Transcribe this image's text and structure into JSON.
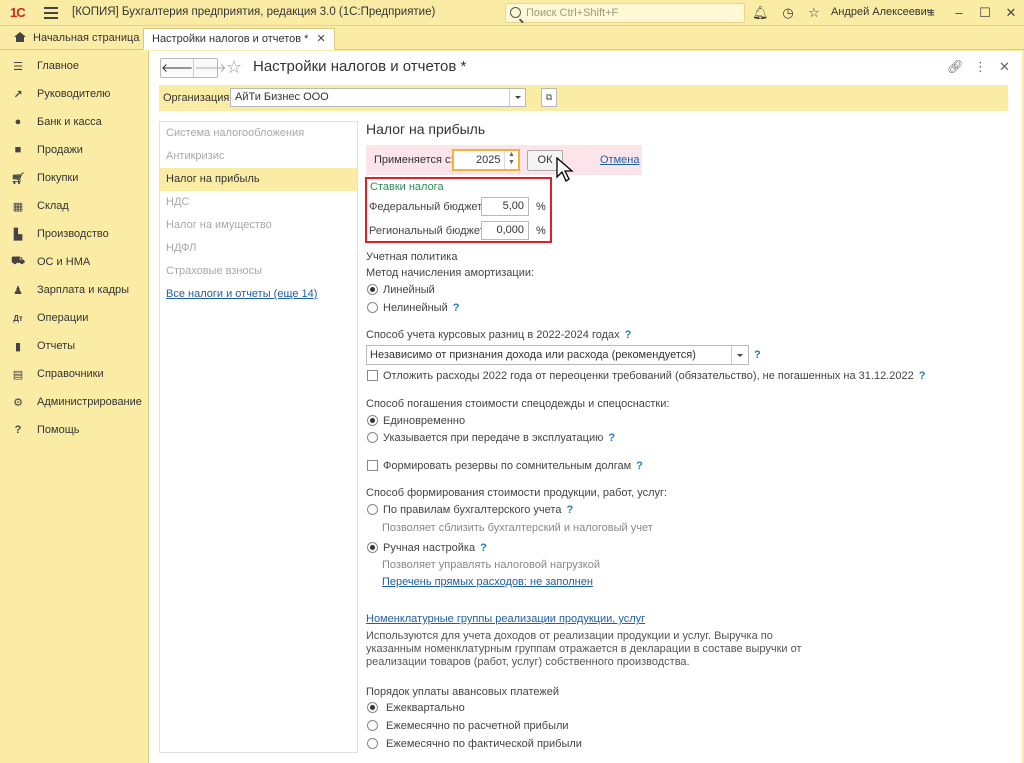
{
  "titlebar": {
    "logo": "1С",
    "title": "[КОПИЯ] Бухгалтерия предприятия, редакция 3.0  (1С:Предприятие)",
    "search_placeholder": "Поиск Ctrl+Shift+F",
    "user": "Андрей Алексеевич"
  },
  "tabs": [
    {
      "label": "Начальная страница"
    },
    {
      "label": "Настройки налогов и отчетов *"
    }
  ],
  "sidebar": {
    "items": [
      {
        "label": "Главное",
        "icon": "menu-icon"
      },
      {
        "label": "Руководителю",
        "icon": "chart-icon"
      },
      {
        "label": "Банк и касса",
        "icon": "coin-icon"
      },
      {
        "label": "Продажи",
        "icon": "bag-icon"
      },
      {
        "label": "Покупки",
        "icon": "cart-icon"
      },
      {
        "label": "Склад",
        "icon": "grid-icon"
      },
      {
        "label": "Производство",
        "icon": "factory-icon"
      },
      {
        "label": "ОС и НМА",
        "icon": "truck-icon"
      },
      {
        "label": "Зарплата и кадры",
        "icon": "person-icon"
      },
      {
        "label": "Операции",
        "icon": "dt-kt-icon"
      },
      {
        "label": "Отчеты",
        "icon": "bar-chart-icon"
      },
      {
        "label": "Справочники",
        "icon": "book-icon"
      },
      {
        "label": "Администрирование",
        "icon": "gear-icon"
      },
      {
        "label": "Помощь",
        "icon": "question-icon"
      }
    ]
  },
  "header": {
    "title": "Настройки налогов и отчетов *",
    "back": "🡐",
    "forward": "🡒"
  },
  "org": {
    "label": "Организация:",
    "value": "АйТи Бизнес ООО"
  },
  "left_panel": {
    "items": [
      {
        "label": "Система налогообложения"
      },
      {
        "label": "Антикризис"
      },
      {
        "label": "Налог на прибыль"
      },
      {
        "label": "НДС"
      },
      {
        "label": "Налог на имущество"
      },
      {
        "label": "НДФЛ"
      },
      {
        "label": "Страховые взносы"
      },
      {
        "label": "Все налоги и отчеты (еще 14)"
      }
    ]
  },
  "form": {
    "title": "Налог на прибыль",
    "applies_label": "Применяется с:",
    "year": "2025",
    "ok": "ОК",
    "cancel": "Отмена",
    "rates_title": "Ставки налога",
    "federal_label": "Федеральный бюджет:",
    "federal_value": "5,00",
    "regional_label": "Региональный бюджет:",
    "regional_value": "0,000",
    "pct": "%",
    "policy_title": "Учетная политика",
    "amort_label": "Метод начисления амортизации:",
    "amort_linear": "Линейный",
    "amort_nonlinear": "Нелинейный",
    "q": "?",
    "fx_label": "Способ учета курсовых разниц в 2022-2024 годах",
    "fx_value": "Независимо от признания дохода или расхода (рекомендуется)",
    "defer_label": "Отложить расходы 2022 года от переоценки требований (обязательство), не погашенных на 31.12.2022",
    "workwear_label": "Способ погашения стоимости спецодежды и спецоснастки:",
    "workwear_once": "Единовременно",
    "workwear_transfer": "Указывается при передаче в эксплуатацию",
    "reserves_label": "Формировать резервы по сомнительным долгам",
    "cost_label": "Способ формирования стоимости продукции, работ, услуг:",
    "cost_rules": "По правилам бухгалтерского учета",
    "cost_rules_hint": "Позволяет сблизить бухгалтерский и налоговый учет",
    "cost_manual": "Ручная настройка",
    "cost_manual_hint": "Позволяет управлять налоговой нагрузкой",
    "direct_costs_link": "Перечень прямых расходов: не заполнен",
    "nom_groups_link": "Номенклатурные группы реализации продукции, услуг",
    "nom_groups_text": "Используются для учета доходов от реализации продукции и услуг. Выручка по указанным номенклатурным группам отражается в декларации в составе выручки от реализации товаров (работ, услуг) собственного производства.",
    "advance_title": "Порядок уплаты авансовых платежей",
    "advance_quarterly": "Ежеквартально",
    "advance_monthly_calc": "Ежемесячно по расчетной прибыли",
    "advance_monthly_actual": "Ежемесячно по фактической прибыли"
  }
}
